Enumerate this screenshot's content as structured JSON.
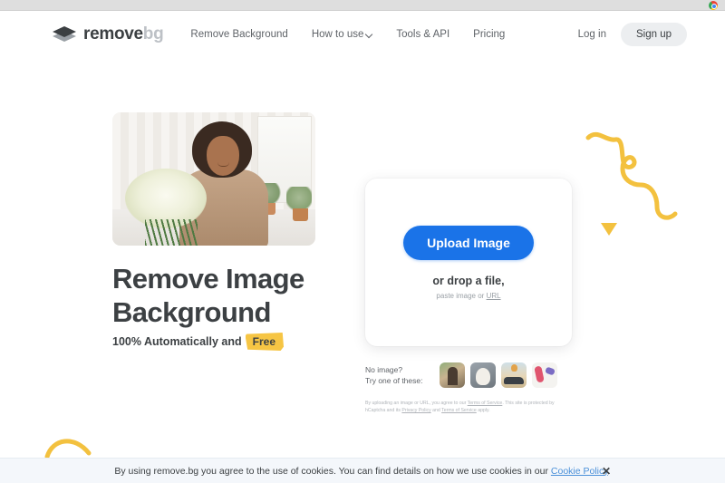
{
  "browser": {
    "chrome_icon": "chrome-icon"
  },
  "header": {
    "logo": {
      "primary": "remove",
      "secondary": "bg",
      "mark_icon": "layers-diamond-icon"
    },
    "nav": [
      {
        "label": "Remove Background",
        "has_dropdown": false
      },
      {
        "label": "How to use",
        "has_dropdown": true,
        "icon": "chevron-down-icon"
      },
      {
        "label": "Tools & API",
        "has_dropdown": false
      },
      {
        "label": "Pricing",
        "has_dropdown": false
      }
    ],
    "login_label": "Log in",
    "signup_label": "Sign up"
  },
  "hero": {
    "photo_alt": "Woman holding a bouquet of white flowers",
    "headline_line1": "Remove Image",
    "headline_line2": "Background",
    "sub_prefix": "100% Automatically and",
    "sub_badge": "Free"
  },
  "upload": {
    "button_label": "Upload Image",
    "drop_text": "or drop a file,",
    "paste_prefix": "paste image or ",
    "paste_link": "URL",
    "samples_line1": "No image?",
    "samples_line2": "Try one of these:",
    "thumbnails": [
      {
        "name": "sample-person"
      },
      {
        "name": "sample-dog"
      },
      {
        "name": "sample-car"
      },
      {
        "name": "sample-product"
      }
    ],
    "legal_part1": "By uploading an image or URL, you agree to our ",
    "legal_tos1": "Terms of Service",
    "legal_part2": ". This site is protected by hCaptcha and its ",
    "legal_privacy": "Privacy Policy",
    "legal_part3": " and ",
    "legal_tos2": "Terms of Service",
    "legal_part4": " apply."
  },
  "decorations": {
    "squiggle": "yellow-squiggle-icon",
    "triangle": "yellow-triangle-icon",
    "arc": "yellow-arc-icon"
  },
  "cookie": {
    "text_prefix": "By using remove.bg you agree to the use of cookies. You can find details on how we use cookies in our ",
    "link_label": "Cookie Policy",
    "text_suffix": ".",
    "close_label": "✕"
  },
  "colors": {
    "accent_blue": "#1a73e8",
    "badge_yellow": "#f6c544",
    "text_dark": "#3c4043",
    "text_gray": "#5f6368",
    "cookie_bg": "#f4f7fb",
    "cookie_link": "#4a90d9"
  }
}
